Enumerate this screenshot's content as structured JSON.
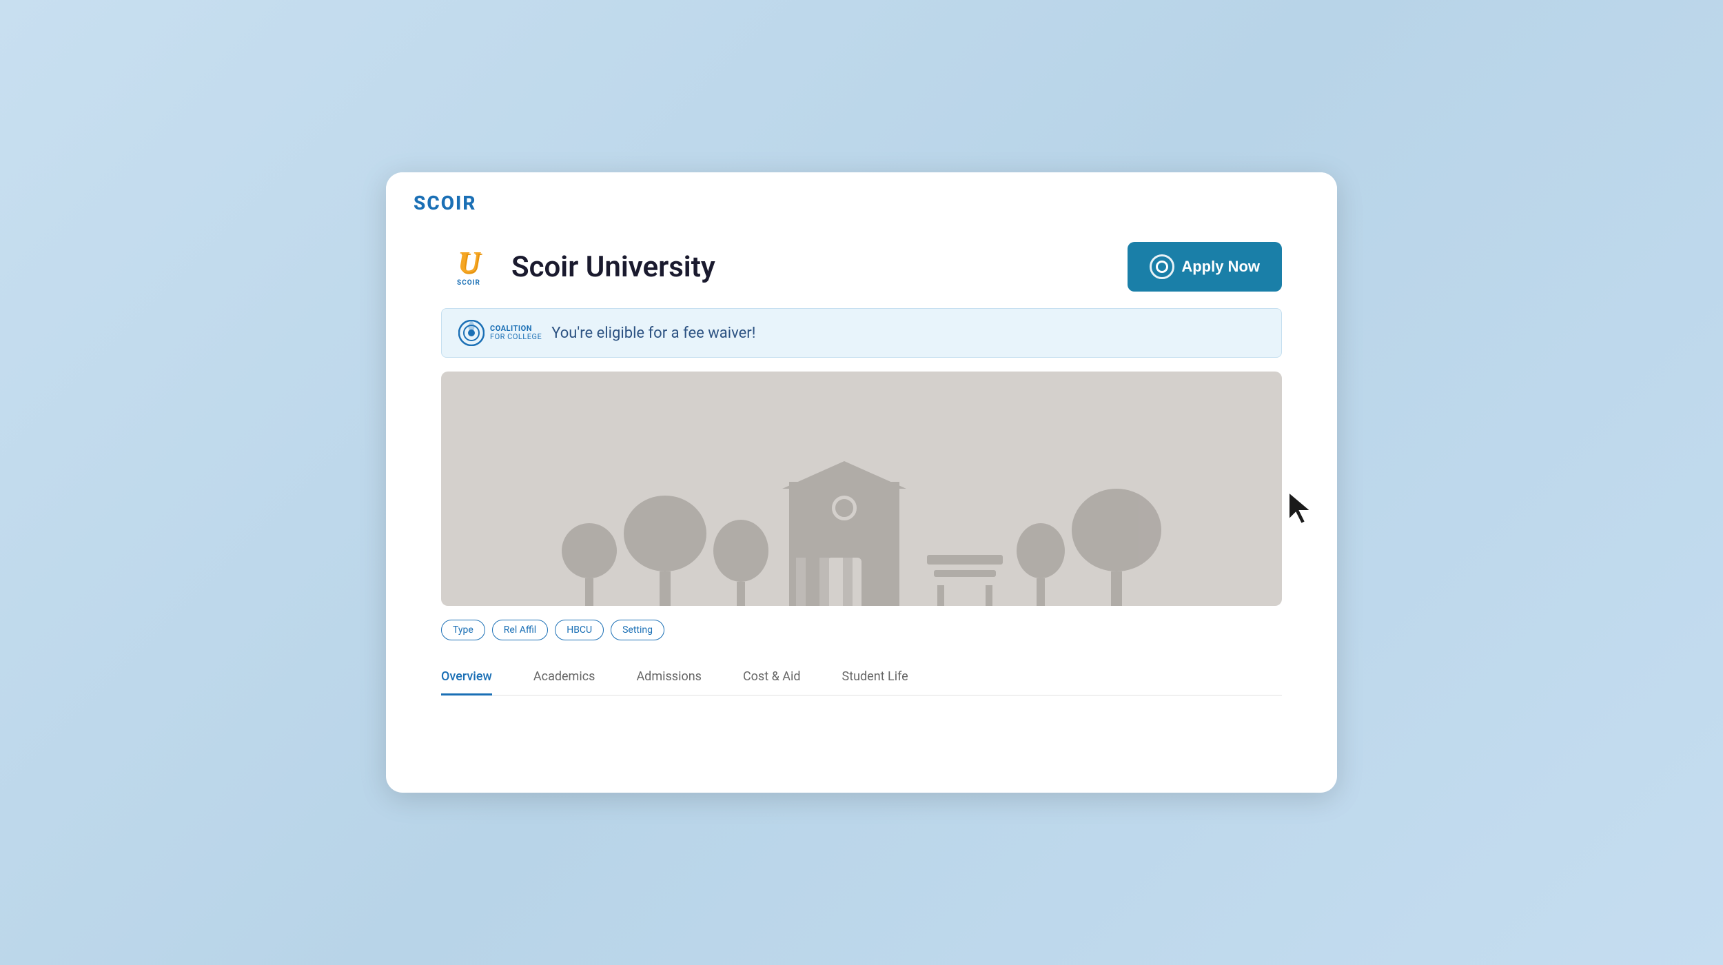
{
  "app": {
    "logo": "SCOIR"
  },
  "university": {
    "logo_letter": "U",
    "logo_subtext": "SCOIR",
    "name": "Scoir University"
  },
  "apply_button": {
    "label": "Apply Now"
  },
  "fee_waiver": {
    "coalition_line1": "COALITION",
    "coalition_line2": "FOR COLLEGE",
    "message": "You're eligible for a fee waiver!"
  },
  "tags": [
    {
      "label": "Type"
    },
    {
      "label": "Rel Affil"
    },
    {
      "label": "HBCU"
    },
    {
      "label": "Setting"
    }
  ],
  "navigation": {
    "tabs": [
      {
        "label": "Overview",
        "active": true
      },
      {
        "label": "Academics",
        "active": false
      },
      {
        "label": "Admissions",
        "active": false
      },
      {
        "label": "Cost & Aid",
        "active": false
      },
      {
        "label": "Student Life",
        "active": false
      }
    ]
  }
}
